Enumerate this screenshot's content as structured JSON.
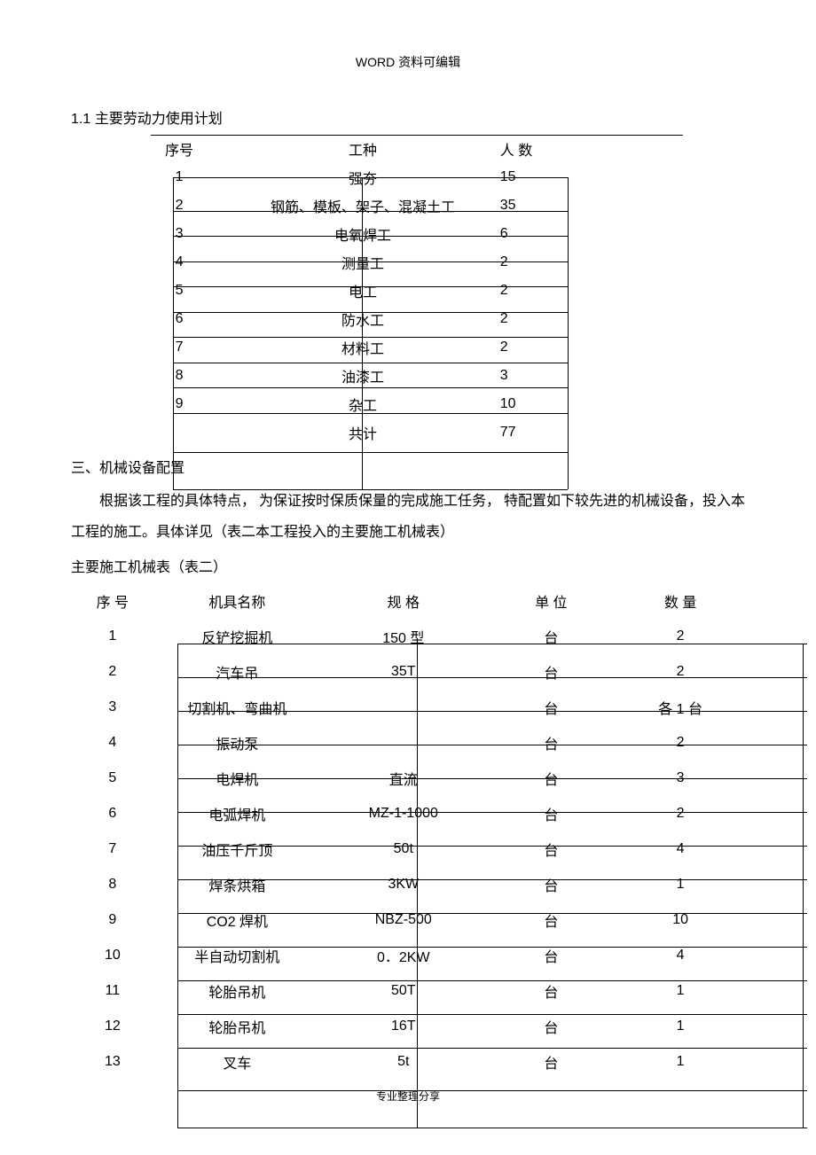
{
  "header": "WORD 资料可编辑",
  "footer": "专业整理分享",
  "section1": {
    "title": "1.1 主要劳动力使用计划",
    "columns": [
      "序号",
      "工种",
      "人 数"
    ],
    "rows": [
      {
        "no": "1",
        "type": "强夯",
        "count": "15"
      },
      {
        "no": "2",
        "type": "钢筋、模板、架子、混凝土工",
        "count": "35"
      },
      {
        "no": "3",
        "type": "电氧焊工",
        "count": "6"
      },
      {
        "no": "4",
        "type": "测量工",
        "count": "2"
      },
      {
        "no": "5",
        "type": "电工",
        "count": "2"
      },
      {
        "no": "6",
        "type": "防水工",
        "count": "2"
      },
      {
        "no": "7",
        "type": "材料工",
        "count": "2"
      },
      {
        "no": "8",
        "type": "油漆工",
        "count": "3"
      },
      {
        "no": "9",
        "type": "杂工",
        "count": "10"
      },
      {
        "no": "",
        "type": "共计",
        "count": "77"
      }
    ]
  },
  "section2": {
    "heading": "三、机械设备配置",
    "para": "根据该工程的具体特点， 为保证按时保质保量的完成施工任务， 特配置如下较先进的机械设备，投入本工程的施工。具体详见（表二本工程投入的主要施工机械表）",
    "subtitle": "主要施工机械表（表二）",
    "columns": [
      "序 号",
      "机具名称",
      "规 格",
      "单 位",
      "数 量"
    ],
    "rows": [
      {
        "no": "1",
        "name": "反铲挖掘机",
        "spec": "150 型",
        "unit": "台",
        "qty": "2"
      },
      {
        "no": "2",
        "name": "汽车吊",
        "spec": "35T",
        "unit": "台",
        "qty": "2"
      },
      {
        "no": "3",
        "name": "切割机、弯曲机",
        "spec": "",
        "unit": "台",
        "qty": "各 1 台"
      },
      {
        "no": "4",
        "name": "振动泵",
        "spec": "",
        "unit": "台",
        "qty": "2"
      },
      {
        "no": "5",
        "name": "电焊机",
        "spec": "直流",
        "unit": "台",
        "qty": "3"
      },
      {
        "no": "6",
        "name": "电弧焊机",
        "spec": "MZ-1-1000",
        "unit": "台",
        "qty": "2"
      },
      {
        "no": "7",
        "name": "油压千斤顶",
        "spec": "50t",
        "unit": "台",
        "qty": "4"
      },
      {
        "no": "8",
        "name": "焊条烘箱",
        "spec": "3KW",
        "unit": "台",
        "qty": "1"
      },
      {
        "no": "9",
        "name": "CO2 焊机",
        "spec": "NBZ-500",
        "unit": "台",
        "qty": "10"
      },
      {
        "no": "10",
        "name": "半自动切割机",
        "spec": "0．2KW",
        "unit": "台",
        "qty": "4"
      },
      {
        "no": "11",
        "name": "轮胎吊机",
        "spec": "50T",
        "unit": "台",
        "qty": "1"
      },
      {
        "no": "12",
        "name": "轮胎吊机",
        "spec": "16T",
        "unit": "台",
        "qty": "1"
      },
      {
        "no": "13",
        "name": "叉车",
        "spec": "5t",
        "unit": "台",
        "qty": "1"
      }
    ]
  }
}
